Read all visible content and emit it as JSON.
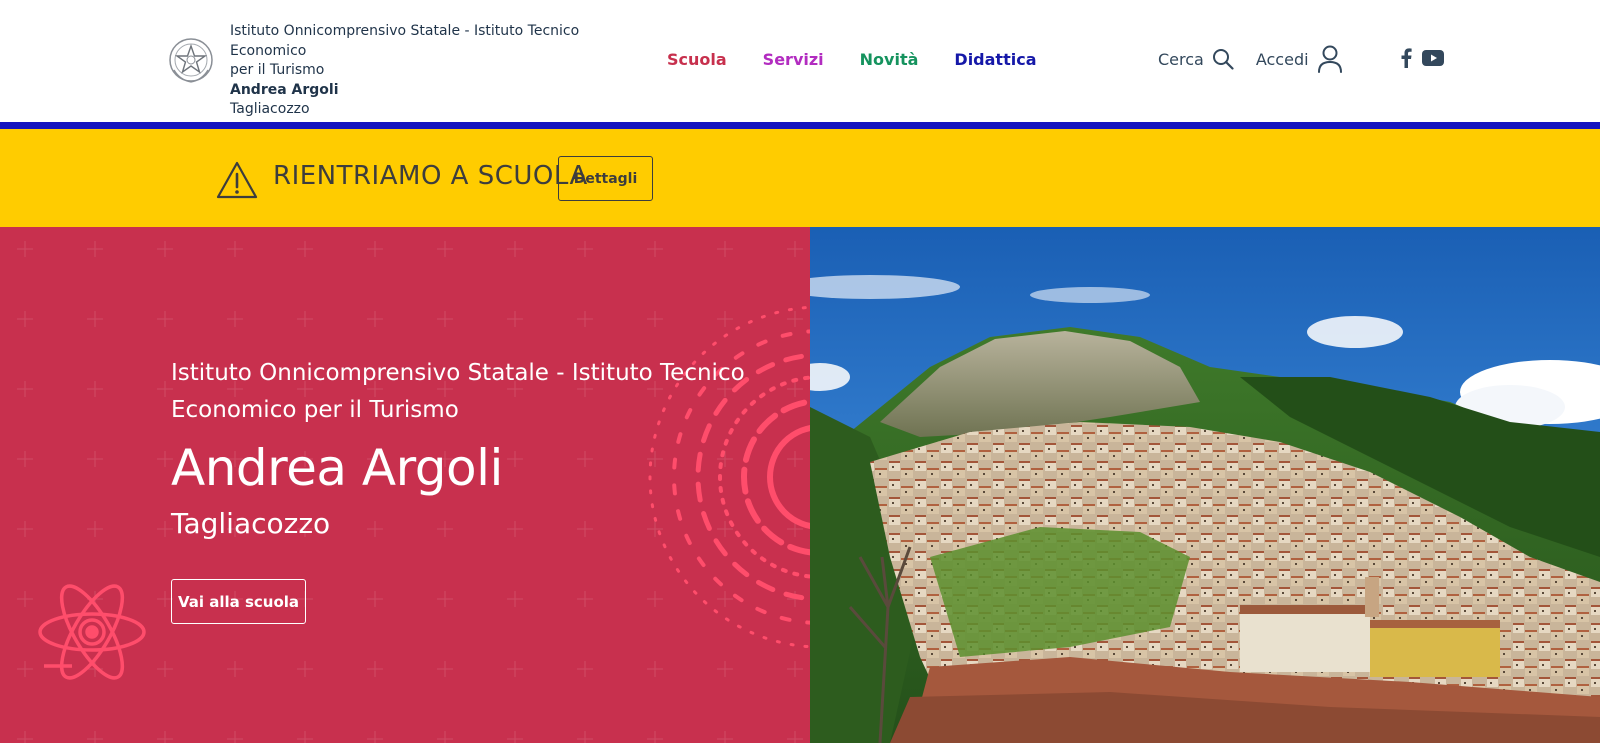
{
  "header": {
    "school_name_line1": "Istituto Onnicomprensivo Statale - Istituto Tecnico Economico",
    "school_name_line2": "per il Turismo",
    "school_name_bold": "Andrea Argoli",
    "school_city": "Tagliacozzo",
    "nav": [
      {
        "label": "Scuola",
        "color": "#c7304d"
      },
      {
        "label": "Servizi",
        "color": "#b22cc0"
      },
      {
        "label": "Novità",
        "color": "#15935e"
      },
      {
        "label": "Didattica",
        "color": "#1518a8"
      }
    ],
    "search_label": "Cerca",
    "login_label": "Accedi",
    "social_icons": [
      "facebook-icon",
      "youtube-icon"
    ],
    "accent_bar_color": "#1515bf"
  },
  "alert": {
    "text": "RIENTRIAMO A SCUOLA",
    "button_label": "Dettagli",
    "background": "#ffcc00",
    "icon": "warning-icon"
  },
  "hero": {
    "pretitle": "Istituto Onnicomprensivo Statale - Istituto Tecnico Economico per il Turismo",
    "title": "Andrea Argoli",
    "subtitle": "Tagliacozzo",
    "button_label": "Vai alla scuola",
    "background": "#c8304e",
    "decorations": [
      "atom-icon",
      "concentric-rings-graphic"
    ],
    "image": "mountain-village-photo"
  }
}
